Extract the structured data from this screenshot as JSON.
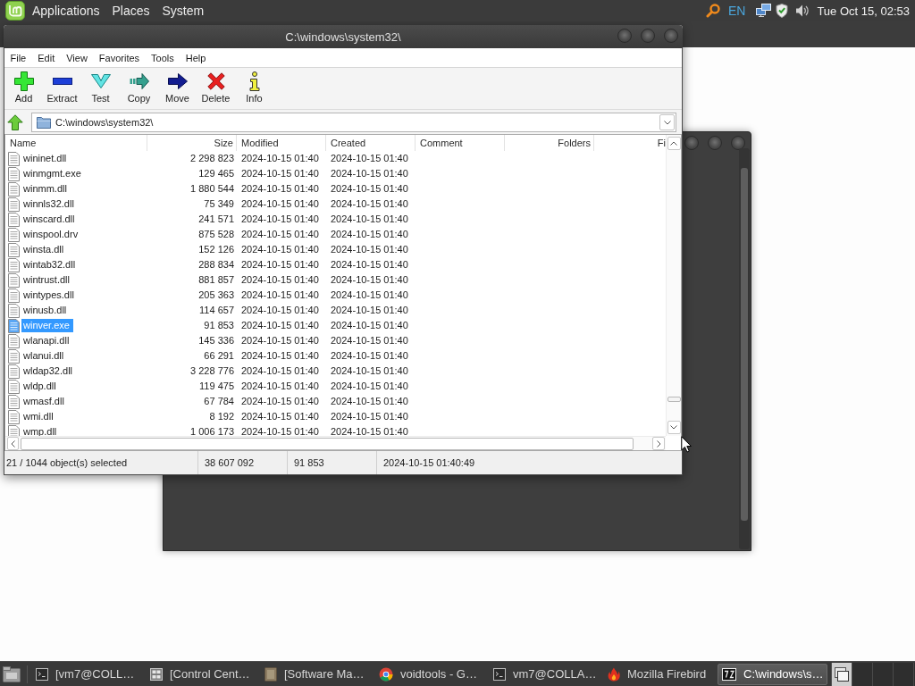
{
  "top_panel": {
    "menus": [
      "Applications",
      "Places",
      "System"
    ],
    "keyboard_layout": "EN",
    "clock": "Tue Oct 15, 02:53"
  },
  "window": {
    "title": "C:\\windows\\system32\\",
    "menu": [
      "File",
      "Edit",
      "View",
      "Favorites",
      "Tools",
      "Help"
    ],
    "toolbar": [
      {
        "label": "Add",
        "kind": "add"
      },
      {
        "label": "Extract",
        "kind": "extract"
      },
      {
        "label": "Test",
        "kind": "test"
      },
      {
        "label": "Copy",
        "kind": "copy"
      },
      {
        "label": "Move",
        "kind": "move"
      },
      {
        "label": "Delete",
        "kind": "delete"
      },
      {
        "label": "Info",
        "kind": "info"
      }
    ],
    "address": "C:\\windows\\system32\\",
    "table": {
      "columns": [
        {
          "label": "Name",
          "align_right": false
        },
        {
          "label": "Size",
          "align_right": true
        },
        {
          "label": "Modified",
          "align_right": false
        },
        {
          "label": "Created",
          "align_right": false
        },
        {
          "label": "Comment",
          "align_right": false
        },
        {
          "label": "Folders",
          "align_right": true
        },
        {
          "label": "Fi",
          "align_right": true
        }
      ],
      "rows": [
        {
          "cells": [
            "wininet.dll",
            "2 298 823",
            "2024-10-15 01:40",
            "2024-10-15 01:40"
          ],
          "selected": false
        },
        {
          "cells": [
            "winmgmt.exe",
            "129 465",
            "2024-10-15 01:40",
            "2024-10-15 01:40"
          ],
          "selected": false
        },
        {
          "cells": [
            "winmm.dll",
            "1 880 544",
            "2024-10-15 01:40",
            "2024-10-15 01:40"
          ],
          "selected": false
        },
        {
          "cells": [
            "winnls32.dll",
            "75 349",
            "2024-10-15 01:40",
            "2024-10-15 01:40"
          ],
          "selected": false
        },
        {
          "cells": [
            "winscard.dll",
            "241 571",
            "2024-10-15 01:40",
            "2024-10-15 01:40"
          ],
          "selected": false
        },
        {
          "cells": [
            "winspool.drv",
            "875 528",
            "2024-10-15 01:40",
            "2024-10-15 01:40"
          ],
          "selected": false
        },
        {
          "cells": [
            "winsta.dll",
            "152 126",
            "2024-10-15 01:40",
            "2024-10-15 01:40"
          ],
          "selected": false
        },
        {
          "cells": [
            "wintab32.dll",
            "288 834",
            "2024-10-15 01:40",
            "2024-10-15 01:40"
          ],
          "selected": false
        },
        {
          "cells": [
            "wintrust.dll",
            "881 857",
            "2024-10-15 01:40",
            "2024-10-15 01:40"
          ],
          "selected": false
        },
        {
          "cells": [
            "wintypes.dll",
            "205 363",
            "2024-10-15 01:40",
            "2024-10-15 01:40"
          ],
          "selected": false
        },
        {
          "cells": [
            "winusb.dll",
            "114 657",
            "2024-10-15 01:40",
            "2024-10-15 01:40"
          ],
          "selected": false
        },
        {
          "cells": [
            "winver.exe",
            "91 853",
            "2024-10-15 01:40",
            "2024-10-15 01:40"
          ],
          "selected": true
        },
        {
          "cells": [
            "wlanapi.dll",
            "145 336",
            "2024-10-15 01:40",
            "2024-10-15 01:40"
          ],
          "selected": false
        },
        {
          "cells": [
            "wlanui.dll",
            "66 291",
            "2024-10-15 01:40",
            "2024-10-15 01:40"
          ],
          "selected": false
        },
        {
          "cells": [
            "wldap32.dll",
            "3 228 776",
            "2024-10-15 01:40",
            "2024-10-15 01:40"
          ],
          "selected": false
        },
        {
          "cells": [
            "wldp.dll",
            "119 475",
            "2024-10-15 01:40",
            "2024-10-15 01:40"
          ],
          "selected": false
        },
        {
          "cells": [
            "wmasf.dll",
            "67 784",
            "2024-10-15 01:40",
            "2024-10-15 01:40"
          ],
          "selected": false
        },
        {
          "cells": [
            "wmi.dll",
            "8 192",
            "2024-10-15 01:40",
            "2024-10-15 01:40"
          ],
          "selected": false
        },
        {
          "cells": [
            "wmp.dll",
            "1 006 173",
            "2024-10-15 01:40",
            "2024-10-15 01:40"
          ],
          "selected": false
        }
      ]
    },
    "status_bar": [
      "21 / 1044 object(s) selected",
      "38 607 092",
      "91 853",
      "2024-10-15 01:40:49"
    ]
  },
  "taskbar": {
    "items": [
      {
        "label": "[vm7@COLL…",
        "kind": "terminal",
        "selected": false
      },
      {
        "label": "[Control Cent…",
        "kind": "control",
        "selected": false
      },
      {
        "label": "[Software Ma…",
        "kind": "software",
        "selected": false
      },
      {
        "label": "voidtools - G…",
        "kind": "browser",
        "selected": false
      },
      {
        "label": "vm7@COLLA…",
        "kind": "terminal",
        "selected": false
      },
      {
        "label": "Mozilla Firebird",
        "kind": "firebird",
        "selected": false
      },
      {
        "label": "C:\\windows\\s…",
        "kind": "archive",
        "selected": true
      }
    ]
  }
}
